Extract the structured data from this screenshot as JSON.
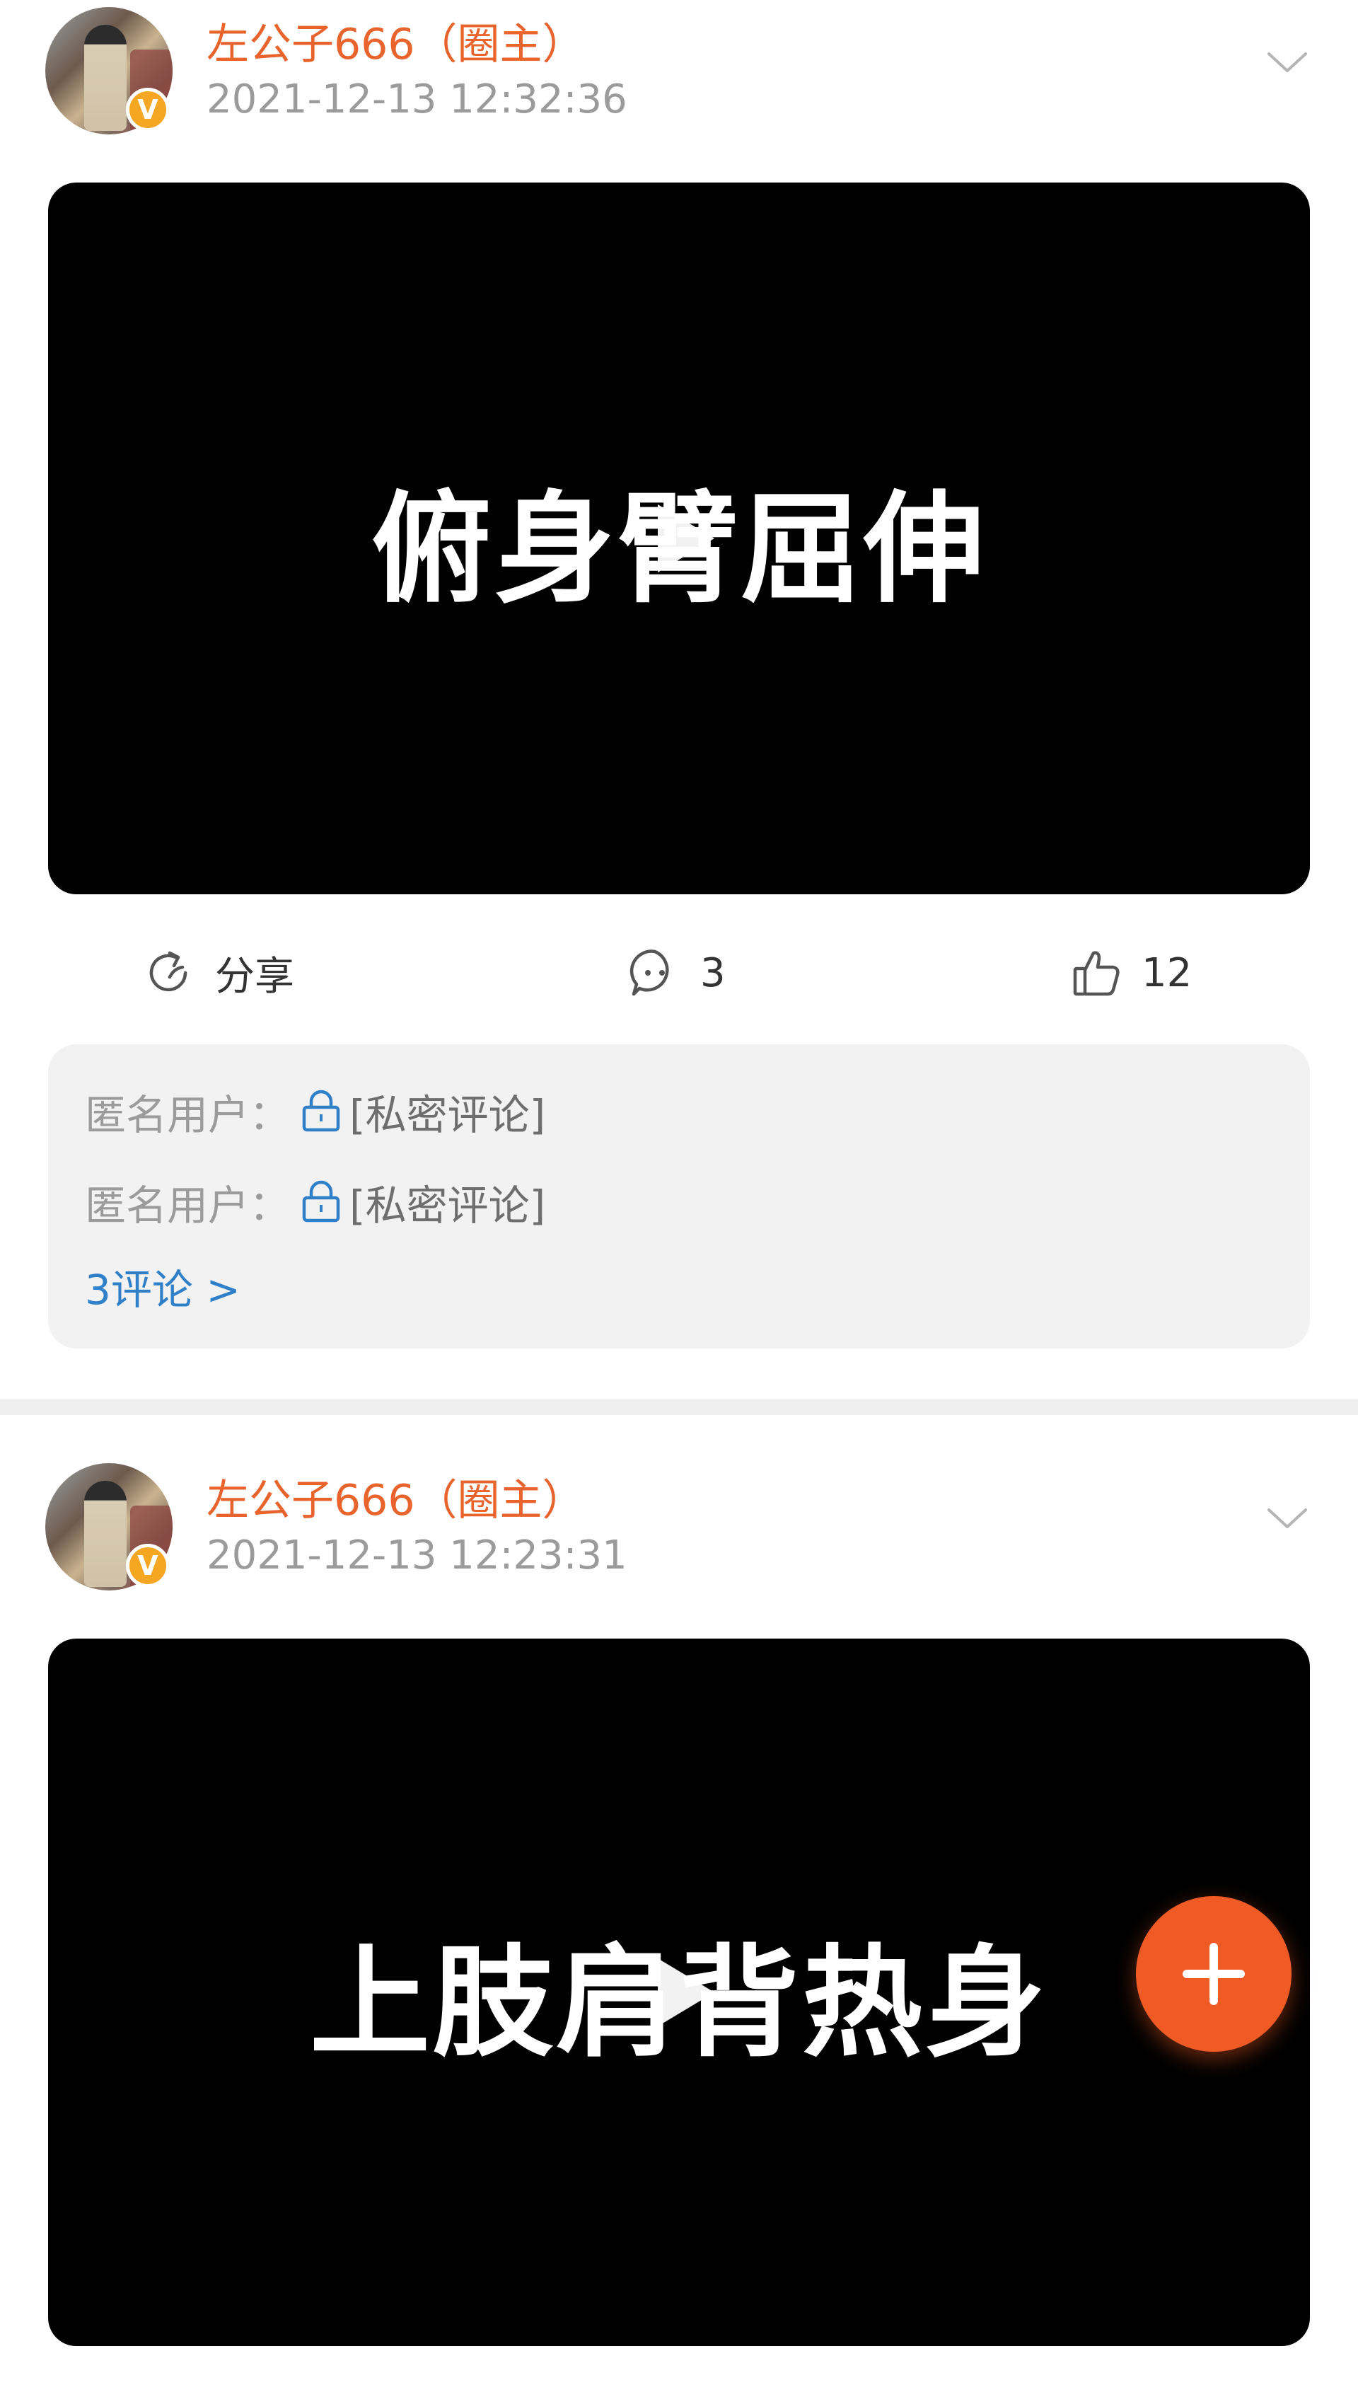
{
  "posts": [
    {
      "author": "左公子666（圈主）",
      "time": "2021-12-13 12:32:36",
      "video_title": "俯身臂屈伸",
      "actions": {
        "share_label": "分享",
        "comment_count": "3",
        "like_count": "12"
      },
      "comments": [
        {
          "user": "匿名用户：",
          "text": "[私密评论]"
        },
        {
          "user": "匿名用户：",
          "text": "[私密评论]"
        }
      ],
      "more_comments": "3评论 >"
    },
    {
      "author": "左公子666（圈主）",
      "time": "2021-12-13 12:23:31",
      "video_title": "上肢肩背热身"
    }
  ],
  "icons": {
    "avatar_badge": "verified-badge-icon",
    "fab": "plus-icon",
    "play": "play-icon",
    "share": "share-icon",
    "comment": "comment-icon",
    "like": "thumbs-up-icon",
    "lock": "lock-icon",
    "chevron": "chevron-down-icon"
  },
  "colors": {
    "author": "#e8642c",
    "timestamp": "#9b9b9b",
    "link": "#2f80c9",
    "fab": "#f05a24",
    "badge": "#f5a623"
  }
}
